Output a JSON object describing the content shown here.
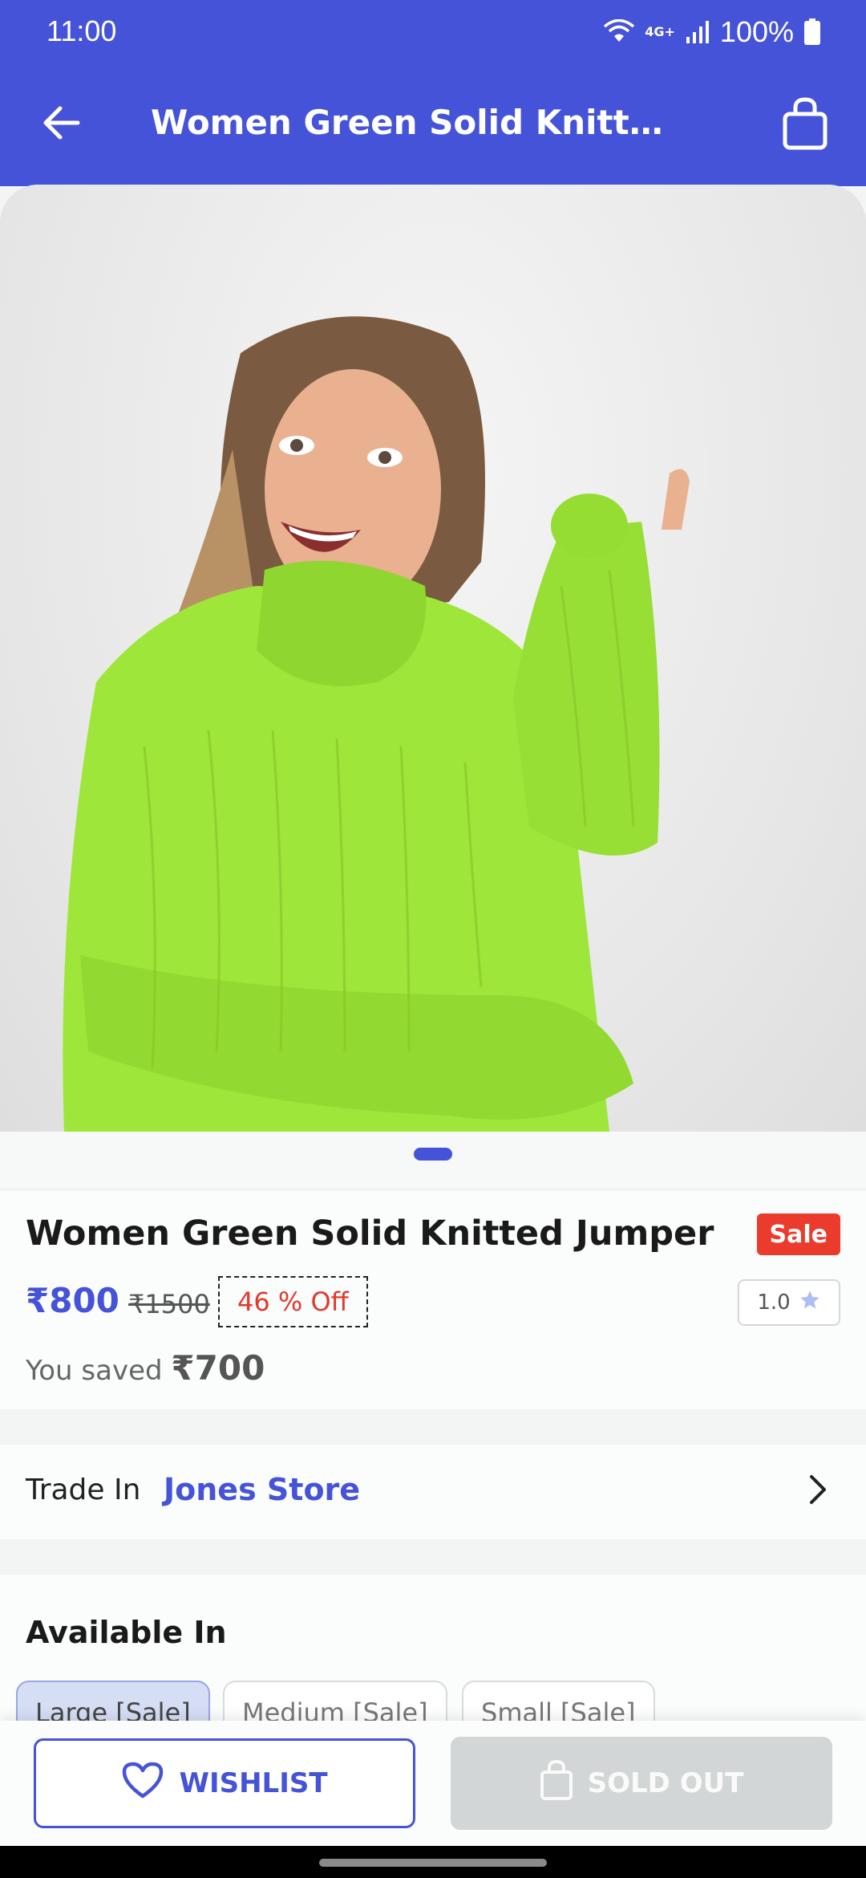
{
  "status_bar": {
    "time": "11:00",
    "network": "4G+",
    "battery": "100%"
  },
  "header": {
    "title": "Women Green Solid Knitted Jumper",
    "back_icon": "arrow-left-icon",
    "bag_icon": "shopping-bag-icon"
  },
  "gallery": {
    "image_description_icon": "product-photo",
    "active_index": 1,
    "count": 1
  },
  "product": {
    "title": "Women Green Solid Knitted Jumper",
    "badge": "Sale",
    "price": "₹800",
    "mrp": "₹1500",
    "discount": "46 % Off",
    "rating": "1.0",
    "saved_label": "You saved",
    "saved_amount": "₹700"
  },
  "trade": {
    "label": "Trade In",
    "store": "Jones Store"
  },
  "availability": {
    "title": "Available In",
    "options": [
      "Large [Sale]",
      "Medium [Sale]",
      "Small [Sale]"
    ],
    "selected": "Large [Sale]"
  },
  "actions": {
    "wishlist_label": "WISHLIST",
    "soldout_label": "SOLD OUT"
  },
  "colors": {
    "accent": "#4553d8",
    "sale": "#ea3b2d",
    "disabled": "#d3d6d6"
  }
}
